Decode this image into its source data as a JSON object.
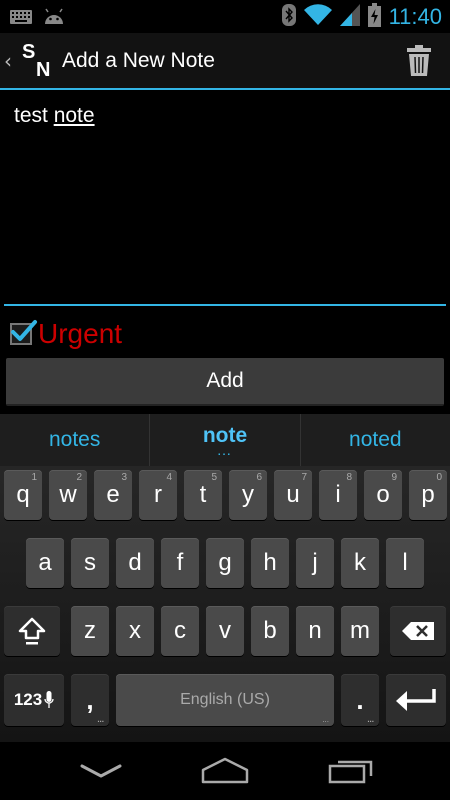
{
  "status_bar": {
    "time": "11:40",
    "icons": [
      "keyboard-icon",
      "android-icon",
      "bluetooth-icon",
      "wifi-icon",
      "signal-icon",
      "battery-charging-icon"
    ]
  },
  "action_bar": {
    "logo": {
      "s": "S",
      "n": "N"
    },
    "title": "Add a New Note",
    "icons": [
      "back-chevron-icon",
      "trash-icon"
    ]
  },
  "note": {
    "text_before": "test ",
    "text_composing": "note"
  },
  "urgent": {
    "label": "Urgent",
    "checked": true,
    "label_color": "#cc0000"
  },
  "add_button": {
    "label": "Add"
  },
  "keyboard": {
    "suggestions": [
      {
        "label": "notes",
        "active": false
      },
      {
        "label": "note",
        "active": true
      },
      {
        "label": "noted",
        "active": false
      }
    ],
    "row1": [
      {
        "label": "q",
        "hint": "1"
      },
      {
        "label": "w",
        "hint": "2"
      },
      {
        "label": "e",
        "hint": "3"
      },
      {
        "label": "r",
        "hint": "4"
      },
      {
        "label": "t",
        "hint": "5"
      },
      {
        "label": "y",
        "hint": "6"
      },
      {
        "label": "u",
        "hint": "7"
      },
      {
        "label": "i",
        "hint": "8"
      },
      {
        "label": "o",
        "hint": "9"
      },
      {
        "label": "p",
        "hint": "0"
      }
    ],
    "row2": [
      "a",
      "s",
      "d",
      "f",
      "g",
      "h",
      "j",
      "k",
      "l"
    ],
    "row3": [
      "z",
      "x",
      "c",
      "v",
      "b",
      "n",
      "m"
    ],
    "symbols_label": "123",
    "comma": ",",
    "period": ".",
    "space_label": "English (US)",
    "more_dots": "..."
  },
  "accent_color": "#33b5e5"
}
